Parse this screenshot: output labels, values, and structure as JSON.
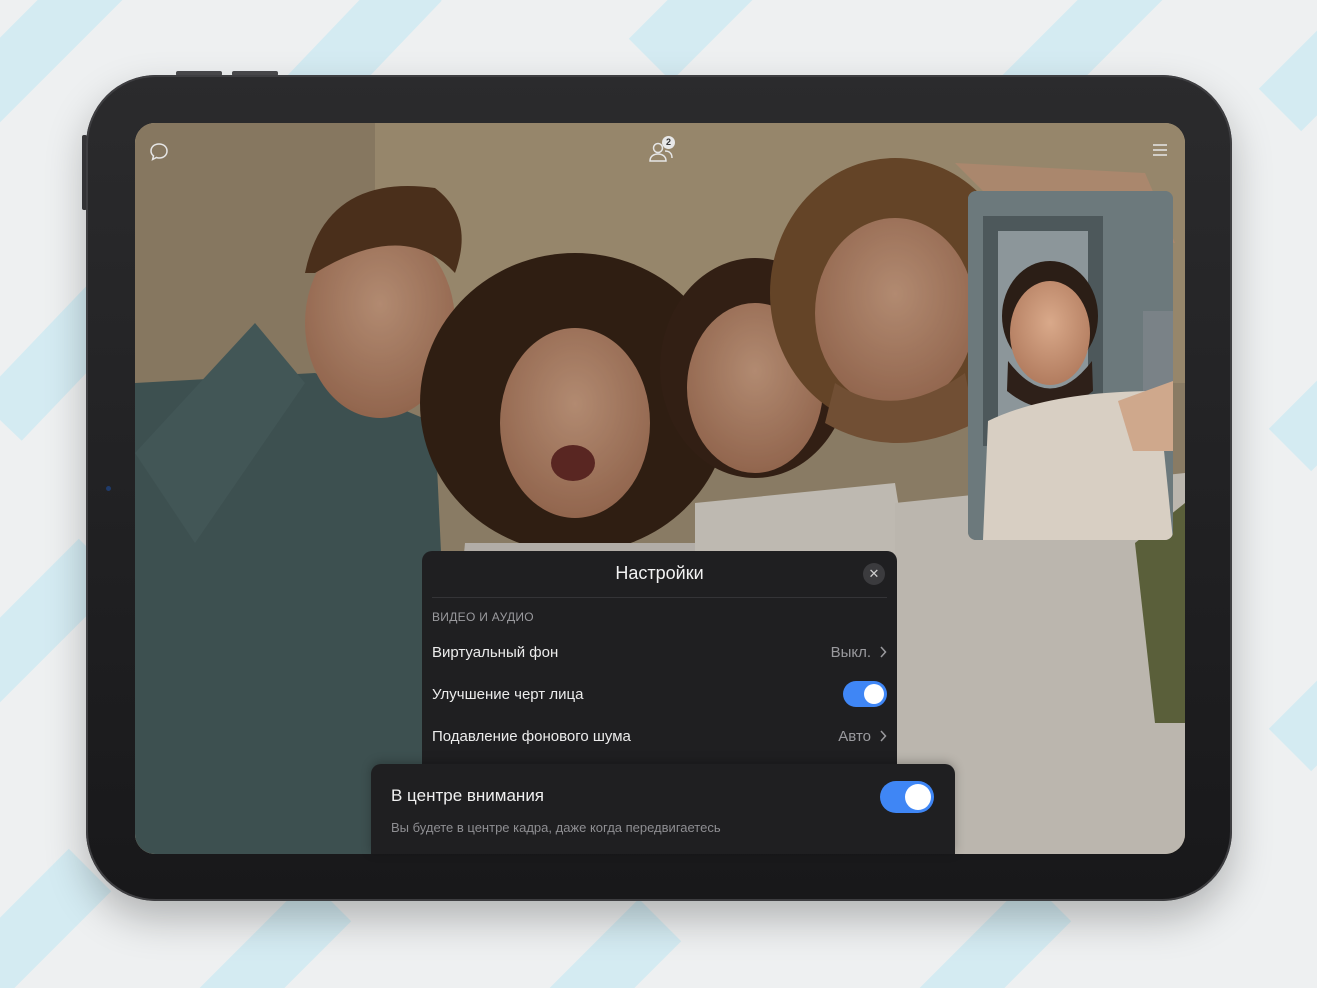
{
  "header": {
    "participants_count": "2"
  },
  "settings": {
    "title": "Настройки",
    "section": "ВИДЕО И АУДИО",
    "rows": [
      {
        "label": "Виртуальный фон",
        "value": "Выкл."
      },
      {
        "label": "Улучшение черт лица",
        "toggle": true
      },
      {
        "label": "Подавление фонового шума",
        "value": "Авто"
      }
    ]
  },
  "spotlight": {
    "title": "В центре внимания",
    "subtitle": "Вы будете в центре кадра, даже когда передвигаетесь",
    "enabled": true
  },
  "colors": {
    "accent": "#3f86f5",
    "panel": "#1f1f21",
    "background_stripes": "#d4ebf2"
  },
  "icons": [
    "chat-icon",
    "participants-icon",
    "menu-icon",
    "close-icon",
    "chevron-right-icon"
  ]
}
